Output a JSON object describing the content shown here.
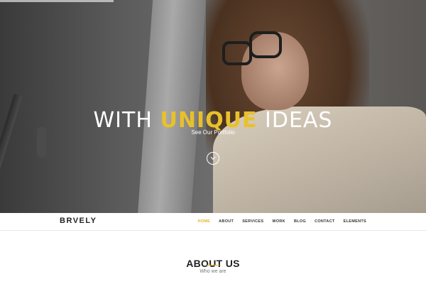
{
  "hero": {
    "title_prefix": "WITH ",
    "title_accent": "UNIQUE",
    "title_suffix": " IDEAS",
    "subtitle": "See Our Portfolio",
    "scroll_icon": "chevron-down-icon"
  },
  "nav": {
    "logo": "BRVELY",
    "items": [
      {
        "label": "HOME",
        "active": true
      },
      {
        "label": "ABOUT"
      },
      {
        "label": "SERVICES"
      },
      {
        "label": "WORK"
      },
      {
        "label": "BLOG"
      },
      {
        "label": "CONTACT"
      },
      {
        "label": "ELEMENTS"
      }
    ]
  },
  "about": {
    "title": "ABOUT US",
    "subtitle": "Who we are"
  },
  "colors": {
    "accent": "#e8b11f",
    "text_dark": "#222222"
  }
}
